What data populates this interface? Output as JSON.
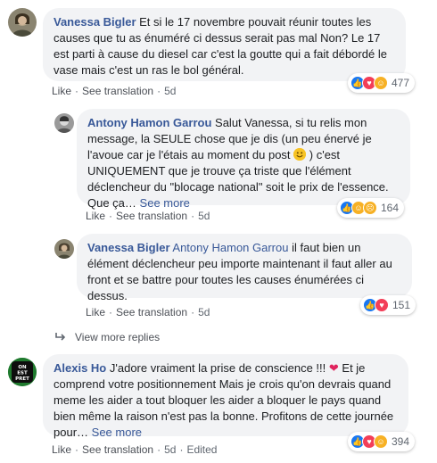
{
  "actions": {
    "like": "Like",
    "see_translation": "See translation",
    "separator": "·"
  },
  "comments": [
    {
      "author": "Vanessa Bigler",
      "text": "Et si le 17 novembre pouvait réunir toutes les causes que tu as énuméré ci dessus serait pas mal Non? Le 17 est parti à cause du diesel car c'est la goutte qui a fait débordé le vase mais c'est un ras le bol général.",
      "time": "5d",
      "reaction_count": "477",
      "reactions": [
        "like-icon",
        "love-icon",
        "haha-icon"
      ]
    },
    {
      "author": "Antony Hamon Garrou",
      "text_1": "Salut Vanessa, si tu relis mon message, la SEULE chose que je dis (un peu énervé je l'avoue car je l'étais au moment du post ",
      "text_2": " ) c'est UNIQUEMENT que je trouve ça triste que l'élément déclencheur du \"blocage national\" soit le prix de l'essence. Que ça…",
      "see_more": "See more",
      "time": "5d",
      "reaction_count": "164",
      "reactions": [
        "like-icon",
        "haha-icon",
        "sad-icon"
      ]
    },
    {
      "author": "Vanessa Bigler",
      "tagged": "Antony Hamon Garrou",
      "text": "il faut bien un élément déclencheur peu importe maintenant il faut aller au front et se battre pour toutes les causes énumérées ci dessus.",
      "time": "5d",
      "reaction_count": "151",
      "reactions": [
        "like-icon",
        "love-icon"
      ]
    },
    {
      "author": "Alexis Ho",
      "text_1": "J'adore vraiment la prise de conscience !!! ",
      "text_2": " Et je comprend votre positionnement Mais je crois qu'on devrais quand meme les aider a tout bloquer les aider a bloquer le pays quand bien même la raison n'est pas la bonne. Profitons de cette journée pour…",
      "see_more": "See more",
      "time": "5d",
      "edited": "Edited",
      "reaction_count": "394",
      "reactions": [
        "like-icon",
        "love-icon",
        "haha-icon"
      ],
      "avatar_text": [
        "ON",
        "EST",
        "PRET"
      ]
    }
  ],
  "view_more_replies": "View more replies",
  "colors": {
    "link": "#385898",
    "bubble": "#f2f3f5",
    "like": "#1877f2",
    "love": "#f33e58",
    "haha": "#f7b125",
    "heart": "#e0245e"
  }
}
